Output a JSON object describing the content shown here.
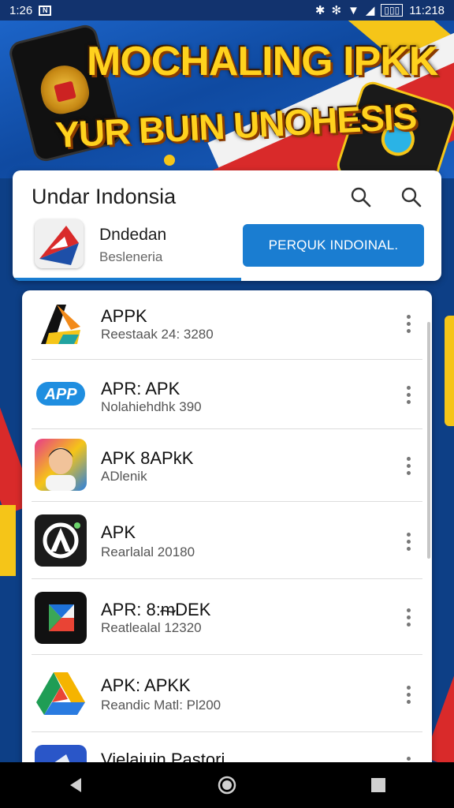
{
  "status_bar": {
    "time_left": "1:26",
    "time_right": "11:218",
    "icons": [
      "bluetooth-icon",
      "vibrate-icon",
      "wifi-icon",
      "signal-icon",
      "battery-icon"
    ],
    "battery_label": "▯▯▯"
  },
  "banner": {
    "title": "MOCHALING IPKK",
    "subtitle": "YUR BUIN UNOHESIS"
  },
  "header": {
    "title": "Undar Indonsia",
    "featured": {
      "name": "Dndedan",
      "subtitle": "Besleneria",
      "button_label": "PERQUK INDOINAL."
    }
  },
  "apps": [
    {
      "name": "APPK",
      "meta": "Reestaak 24: 3280",
      "icon": "arrow-logo-icon"
    },
    {
      "name": "APR: APK",
      "meta": "Nolahiehdhk 390",
      "icon": "app-badge-icon"
    },
    {
      "name": "APK 8APkK",
      "meta": "ADlenik",
      "icon": "avatar-icon"
    },
    {
      "name": "APK",
      "meta": "Rearlalal 20180",
      "icon": "a-circle-icon"
    },
    {
      "name": "APR: 8:ᵯDEK",
      "meta": "Reatlealal 12320",
      "icon": "play-shape-icon"
    },
    {
      "name": "APK: APKK",
      "meta": "Reandic Matl: Pl200",
      "icon": "drive-triangle-icon"
    },
    {
      "name": "Vielaiuin Pastori",
      "meta": "",
      "icon": "blue-app-icon"
    }
  ],
  "colors": {
    "accent": "#1a7dd1",
    "banner_text": "#ffd21e",
    "nav_bar": "#000000"
  }
}
